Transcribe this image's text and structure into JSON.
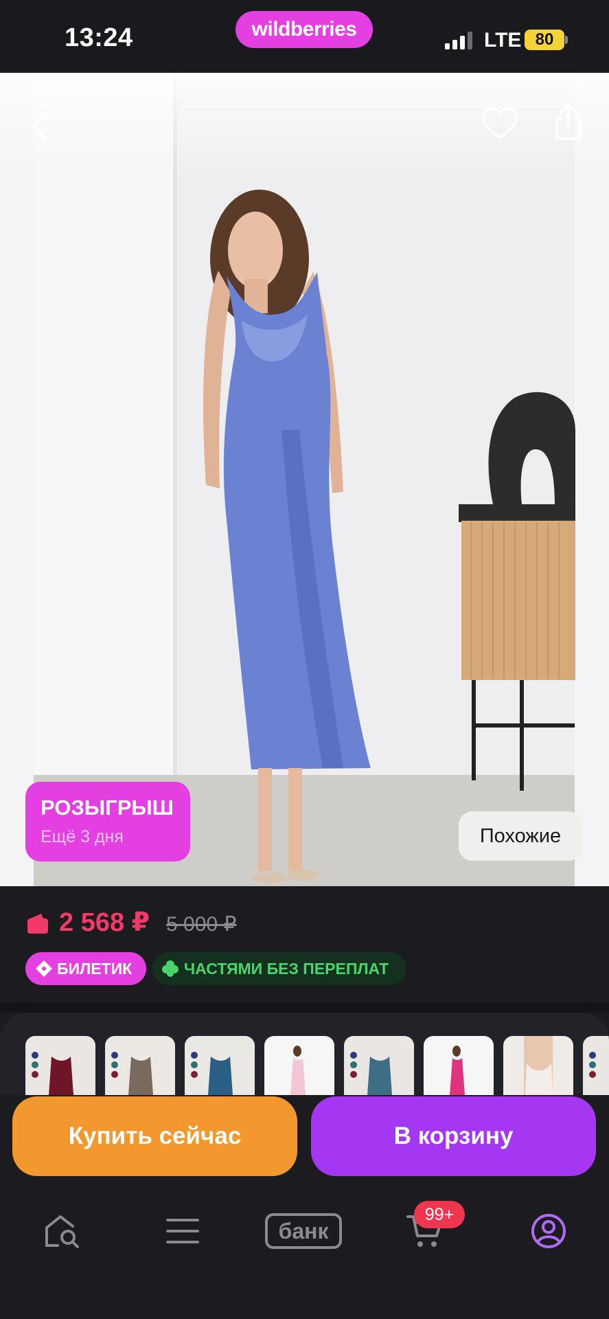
{
  "status_bar": {
    "time": "13:24",
    "brand": "wildberries",
    "network": "LTE",
    "battery": "80"
  },
  "product": {
    "promo": {
      "title": "РОЗЫГРЫШ",
      "subtitle": "Ещё 3 дня"
    },
    "similar_label": "Похожие",
    "price": "2 568 ₽",
    "old_price": "5 000 ₽",
    "chips": {
      "ticket": "БИЛЕТИК",
      "installments": "ЧАСТЯМИ БЕЗ ПЕРЕПЛАТ"
    },
    "thumbnail_count": 8
  },
  "actions": {
    "buy_now": "Купить сейчас",
    "add_to_cart": "В корзину"
  },
  "tabbar": {
    "bank": "банк",
    "cart_badge": "99+"
  },
  "colors": {
    "brand": "#e43fe0",
    "price": "#f23a68",
    "buy_button": "#f2982e",
    "cart_button": "#a537f2",
    "installments_text": "#49d46d",
    "badge": "#f0354e"
  },
  "icons": [
    "back-icon",
    "heart-icon",
    "share-icon",
    "wallet-icon",
    "ticket-icon",
    "clover-icon",
    "home-search-icon",
    "menu-icon",
    "cart-icon",
    "profile-icon"
  ]
}
